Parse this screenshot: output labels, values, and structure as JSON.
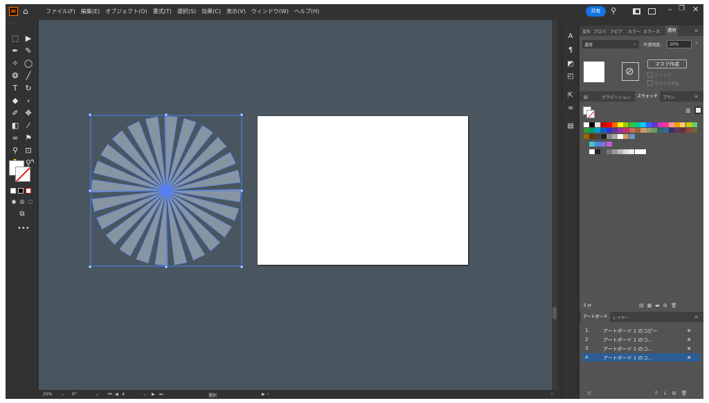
{
  "menu": {
    "app_badge": "Ai",
    "items": [
      "ファイル(F)",
      "編集(E)",
      "オブジェクト(O)",
      "書式(T)",
      "選択(S)",
      "効果(C)",
      "表示(V)",
      "ウィンドウ(W)",
      "ヘルプ(H)"
    ],
    "share_label": "共有"
  },
  "status_bar": {
    "zoom": "25%",
    "rotation": "0°",
    "artboard_number": "4",
    "tool_label": "選択"
  },
  "transparency_panel": {
    "tabs": [
      "変形",
      "プロパ",
      "アピア",
      "カラー",
      "カラーガ",
      "透明"
    ],
    "active_tab": "透明",
    "blend_mode": "通常",
    "opacity_label": "不透明度：",
    "opacity_value": "20%",
    "make_mask_button": "マスク作成",
    "clip_label": "クリップ",
    "invert_mask_label": "マスクを反転"
  },
  "swatches_panel": {
    "tabs": [
      "線",
      "グラデーション",
      "スウォッチ",
      "ブラシ"
    ],
    "active_tab": "スウォッチ"
  },
  "artboards_panel": {
    "tabs": [
      "アートボード",
      "レイヤー"
    ],
    "rows": [
      {
        "num": "1",
        "name": "アートボード 1 のコピー"
      },
      {
        "num": "2",
        "name": "アートボード 1 のコ..."
      },
      {
        "num": "3",
        "name": "アートボード 1 のコ..."
      },
      {
        "num": "4",
        "name": "アートボード 1 のコ..."
      }
    ],
    "selected_index": 3
  },
  "colors": {
    "canvas": "#49565f",
    "sunburst_ray": "#8795a3",
    "selection": "#4f7ff0",
    "accent": "#1473e6"
  },
  "sunburst_ray_count": 24
}
